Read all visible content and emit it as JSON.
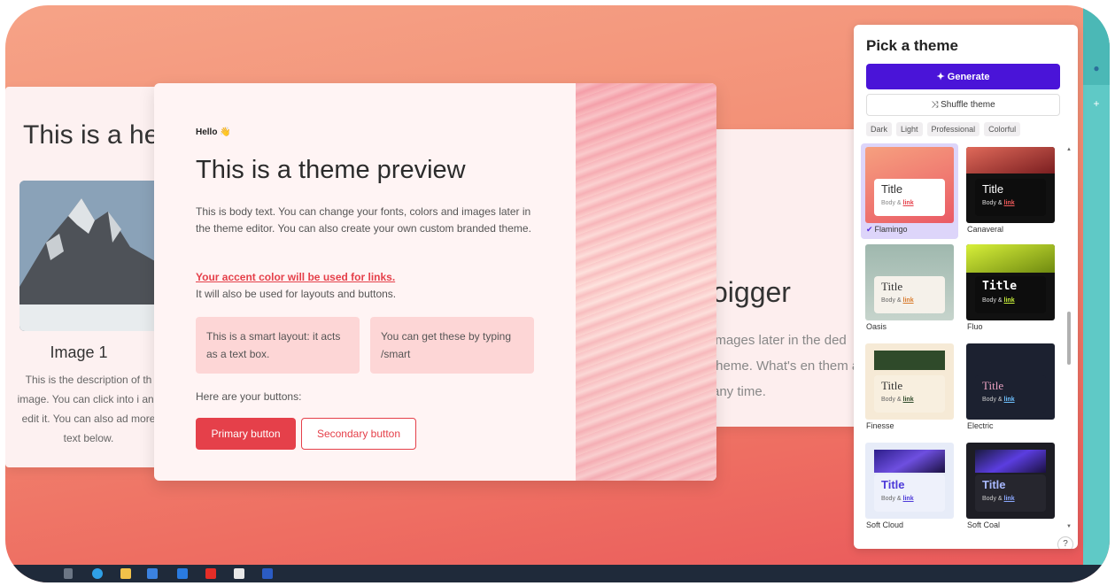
{
  "left_card": {
    "heading": "This is a he",
    "image_title": "Image 1",
    "image_desc": "This is the description of th image. You can click into i and edit it. You can also ad more text below."
  },
  "right_card": {
    "heading": "oigger",
    "body": "images later in the ded theme. What's en them at any time."
  },
  "preview": {
    "hello": "Hello 👋",
    "title": "This is a theme preview",
    "body": "This is body text. You can change your fonts, colors and images later in the theme editor. You can also create your own custom branded theme.",
    "accent_link": "Your accent color will be used for links.",
    "accent_sub": "It will also be used for layouts and buttons.",
    "smart_box_1": "This is a smart layout: it acts as a text box.",
    "smart_box_2": "You can get these by typing /smart",
    "buttons_label": "Here are your buttons:",
    "primary_button": "Primary button",
    "secondary_button": "Secondary button"
  },
  "panel": {
    "title": "Pick a theme",
    "generate": "✦ Generate",
    "shuffle": "⤨ Shuffle theme",
    "filters": [
      "Dark",
      "Light",
      "Professional",
      "Colorful"
    ],
    "theme_title": "Title",
    "theme_body": "Body &",
    "theme_link": "link",
    "themes": [
      {
        "name": "Flamingo",
        "selected": true
      },
      {
        "name": "Canaveral",
        "selected": false
      },
      {
        "name": "Oasis",
        "selected": false
      },
      {
        "name": "Fluo",
        "selected": false
      },
      {
        "name": "Finesse",
        "selected": false
      },
      {
        "name": "Electric",
        "selected": false
      },
      {
        "name": "Soft Cloud",
        "selected": false
      },
      {
        "name": "Soft Coal",
        "selected": false
      }
    ],
    "help": "?"
  },
  "colors": {
    "accent": "#e5404a",
    "generate_bg": "#4a14d8",
    "selected_tile": "#ddd5fa"
  }
}
